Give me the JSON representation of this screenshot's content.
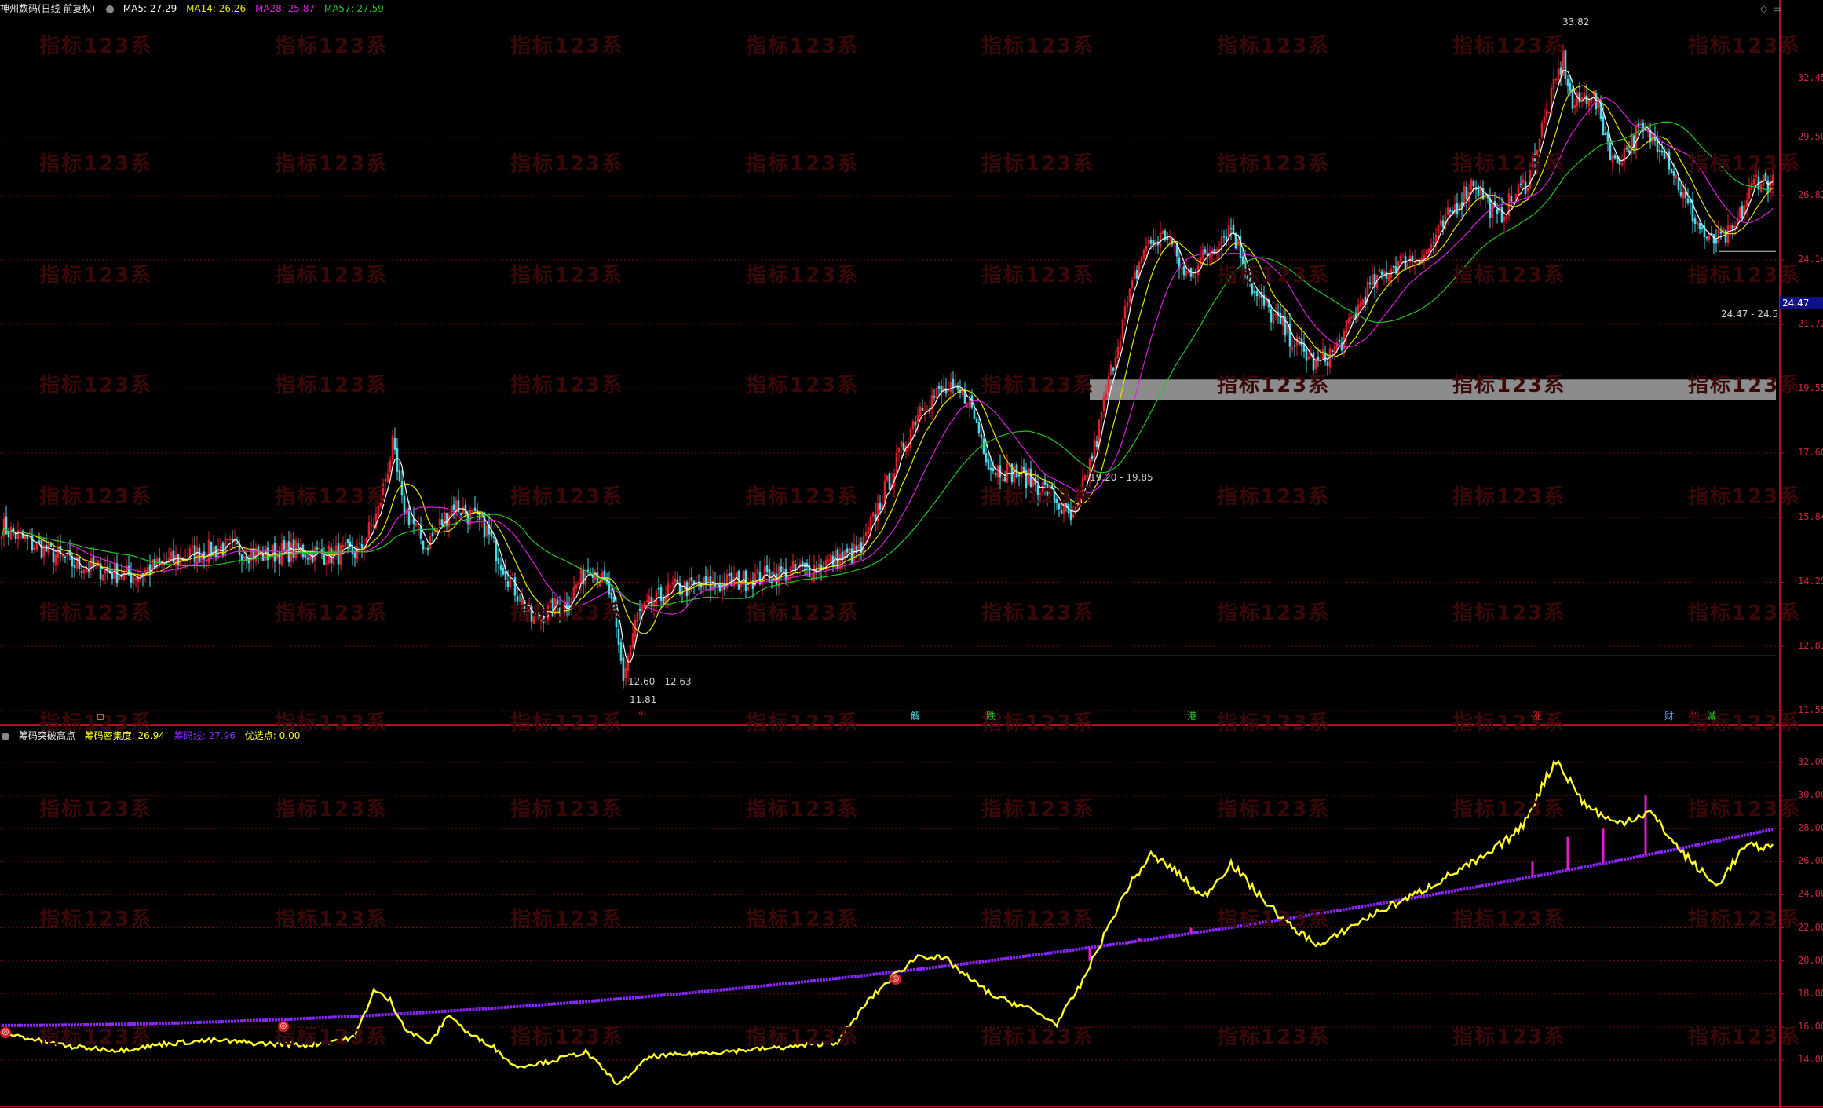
{
  "colors": {
    "bg": "#000000",
    "grid": "#6e0b13",
    "frame": "#b01024",
    "up": "#e0202c",
    "down": "#4fd9e8",
    "ma5": "#ffffff",
    "ma14": "#e6e600",
    "ma28": "#e020e0",
    "ma57": "#23c823",
    "conc": "#ffff2a",
    "chipline": "#8a28ff",
    "spike": "#e020c8",
    "axis_text": "#c8283a"
  },
  "header": {
    "stock_title": "神州数码(日线 前复权)",
    "ma5": "MA5: 27.29",
    "ma14": "MA14: 26.26",
    "ma28": "MA28: 25.87",
    "ma57": "MA57: 27.59"
  },
  "sub_header": {
    "indicator": "筹码突破高点",
    "conc": "筹码密集度: 26.94",
    "line": "筹码线: 27.96",
    "pick": "优选点: 0.00"
  },
  "window_controls": {
    "diamond": "◇",
    "restore": "▭"
  },
  "main_axis": [
    "32.45",
    "29.50",
    "26.82",
    "24.14",
    "21.72",
    "19.55",
    "17.60",
    "15.84",
    "14.25",
    "12.83",
    "11.55"
  ],
  "sub_axis": [
    "32.00",
    "30.00",
    "28.00",
    "26.00",
    "24.00",
    "22.00",
    "20.00",
    "18.00",
    "16.00",
    "14.00"
  ],
  "current_price": "24.47",
  "annotations": {
    "high": "33.82",
    "low": "11.81",
    "low_range": "12.60 - 12.63",
    "gap_range": "19.20 - 19.85",
    "recent_range": "24.47 - 24.5"
  },
  "events": [
    {
      "label": "◻",
      "color": "#e6a070"
    },
    {
      "label": "⺌",
      "color": "#e02020"
    },
    {
      "label": "解",
      "color": "#4fd9e8"
    },
    {
      "label": "跌",
      "color": "#23c823"
    },
    {
      "label": "港",
      "color": "#23c823"
    },
    {
      "label": "涨",
      "color": "#e02020"
    },
    {
      "label": "财",
      "color": "#4fa0ff"
    },
    {
      "label": "⺌",
      "color": "#e02020"
    },
    {
      "label": "減",
      "color": "#23c823"
    }
  ],
  "signal_marker": "◎",
  "watermark": "指标123系",
  "chart_data": {
    "type": "candlestick",
    "title": "神州数码(日线 前复权)",
    "price_axis": {
      "ticks": [
        32.45,
        29.5,
        26.82,
        24.14,
        21.72,
        19.55,
        17.6,
        15.84,
        14.25,
        12.83,
        11.55
      ],
      "range": [
        11.0,
        35.0
      ]
    },
    "price_path": [
      [
        0,
        15.6
      ],
      [
        12,
        15.2
      ],
      [
        30,
        14.7
      ],
      [
        55,
        14.4
      ],
      [
        80,
        14.9
      ],
      [
        95,
        15.1
      ],
      [
        110,
        14.9
      ],
      [
        125,
        15.0
      ],
      [
        140,
        14.9
      ],
      [
        152,
        15.0
      ],
      [
        160,
        16.0
      ],
      [
        166,
        17.8
      ],
      [
        170,
        16.2
      ],
      [
        180,
        15.1
      ],
      [
        192,
        16.2
      ],
      [
        205,
        15.6
      ],
      [
        215,
        14.4
      ],
      [
        225,
        13.4
      ],
      [
        240,
        13.8
      ],
      [
        250,
        14.7
      ],
      [
        258,
        14.0
      ],
      [
        264,
        12.2
      ],
      [
        270,
        13.5
      ],
      [
        285,
        14.1
      ],
      [
        305,
        14.2
      ],
      [
        325,
        14.4
      ],
      [
        345,
        14.6
      ],
      [
        365,
        15.0
      ],
      [
        378,
        17.0
      ],
      [
        390,
        19.0
      ],
      [
        400,
        19.5
      ],
      [
        410,
        19.3
      ],
      [
        420,
        17.2
      ],
      [
        433,
        17.0
      ],
      [
        445,
        16.5
      ],
      [
        455,
        15.7
      ],
      [
        465,
        18.0
      ],
      [
        475,
        21.5
      ],
      [
        485,
        24.6
      ],
      [
        495,
        25.2
      ],
      [
        502,
        23.5
      ],
      [
        512,
        24.4
      ],
      [
        522,
        25.5
      ],
      [
        532,
        22.8
      ],
      [
        548,
        21.2
      ],
      [
        558,
        20.3
      ],
      [
        568,
        21.0
      ],
      [
        580,
        23.0
      ],
      [
        592,
        24.0
      ],
      [
        605,
        24.4
      ],
      [
        615,
        26.0
      ],
      [
        625,
        27.5
      ],
      [
        635,
        25.8
      ],
      [
        648,
        27.5
      ],
      [
        658,
        31.5
      ],
      [
        663,
        33.5
      ],
      [
        667,
        31.0
      ],
      [
        675,
        31.8
      ],
      [
        685,
        28.2
      ],
      [
        695,
        29.8
      ],
      [
        705,
        29.2
      ],
      [
        715,
        26.5
      ],
      [
        725,
        24.8
      ],
      [
        735,
        25.2
      ],
      [
        745,
        27.6
      ],
      [
        752,
        27.3
      ]
    ],
    "moving_averages": {
      "MA5": {
        "last": 27.29
      },
      "MA14": {
        "last": 26.26
      },
      "MA28": {
        "last": 25.87
      },
      "MA57": {
        "last": 27.59
      }
    },
    "indicator": {
      "name": "筹码突破高点",
      "axis_ticks": [
        32,
        30,
        28,
        26,
        24,
        22,
        20,
        18,
        16,
        14
      ],
      "range": [
        12.5,
        33.8
      ],
      "density_path": [
        [
          0,
          15.7
        ],
        [
          15,
          15.2
        ],
        [
          30,
          14.8
        ],
        [
          50,
          14.6
        ],
        [
          70,
          15.0
        ],
        [
          90,
          15.2
        ],
        [
          110,
          15.0
        ],
        [
          130,
          14.9
        ],
        [
          150,
          15.4
        ],
        [
          158,
          18.2
        ],
        [
          165,
          17.6
        ],
        [
          172,
          15.8
        ],
        [
          182,
          15.0
        ],
        [
          190,
          16.8
        ],
        [
          198,
          15.6
        ],
        [
          208,
          14.9
        ],
        [
          218,
          13.6
        ],
        [
          232,
          13.9
        ],
        [
          248,
          14.5
        ],
        [
          262,
          12.5
        ],
        [
          275,
          14.2
        ],
        [
          295,
          14.4
        ],
        [
          315,
          14.6
        ],
        [
          335,
          14.8
        ],
        [
          355,
          15.1
        ],
        [
          368,
          17.6
        ],
        [
          378,
          19.0
        ],
        [
          390,
          20.4
        ],
        [
          402,
          20.0
        ],
        [
          412,
          18.8
        ],
        [
          422,
          17.8
        ],
        [
          435,
          17.2
        ],
        [
          448,
          16.2
        ],
        [
          458,
          18.5
        ],
        [
          468,
          21.5
        ],
        [
          478,
          24.4
        ],
        [
          488,
          26.4
        ],
        [
          498,
          25.5
        ],
        [
          510,
          23.8
        ],
        [
          522,
          25.9
        ],
        [
          535,
          23.8
        ],
        [
          548,
          22.0
        ],
        [
          560,
          20.9
        ],
        [
          572,
          22.0
        ],
        [
          585,
          23.0
        ],
        [
          600,
          24.0
        ],
        [
          615,
          25.2
        ],
        [
          630,
          26.3
        ],
        [
          645,
          28.0
        ],
        [
          660,
          32.2
        ],
        [
          672,
          29.5
        ],
        [
          685,
          28.3
        ],
        [
          700,
          29.0
        ],
        [
          712,
          26.8
        ],
        [
          728,
          24.5
        ],
        [
          740,
          26.9
        ],
        [
          752,
          26.9
        ]
      ],
      "chip_line": {
        "start": 16.1,
        "end": 27.96
      },
      "spikes": [
        [
          462,
          20.0
        ],
        [
          478,
          21.0
        ],
        [
          483,
          21.4
        ],
        [
          505,
          22.0
        ],
        [
          650,
          26.0
        ],
        [
          665,
          27.5
        ],
        [
          680,
          28.0
        ],
        [
          698,
          30.0
        ]
      ],
      "signals": [
        2,
        120,
        380
      ]
    }
  }
}
